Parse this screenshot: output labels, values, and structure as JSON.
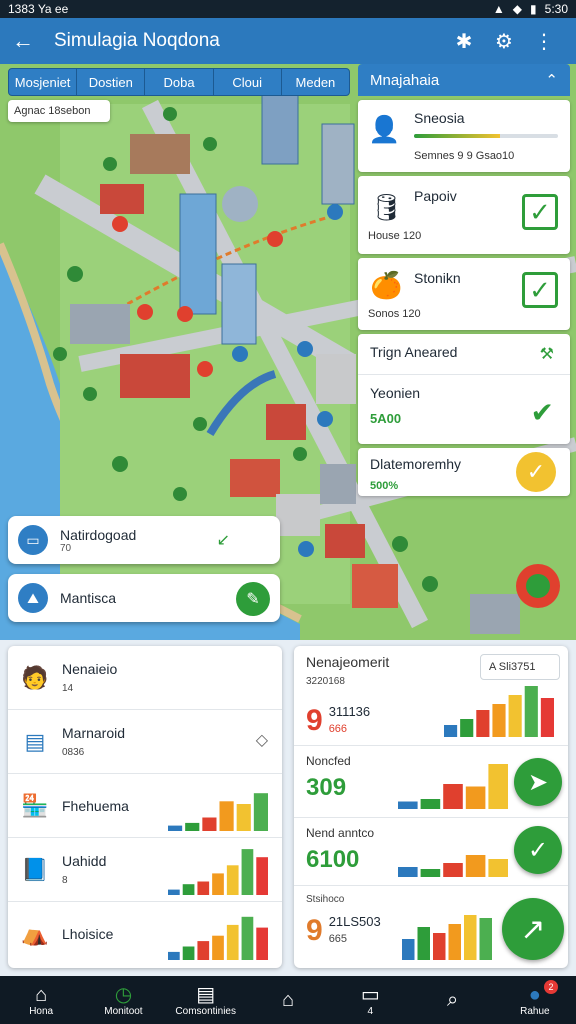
{
  "status": {
    "time": "1383 Ya ee",
    "battery": "5:30"
  },
  "appbar": {
    "title": "Simulagia Noqdona"
  },
  "tabs": [
    "Mosjeniet",
    "Dostien",
    "Doba",
    "Cloui",
    "Meden"
  ],
  "address": "Agnac 18sebon",
  "right_panel": {
    "title": "Mnajahaia",
    "items": [
      {
        "title": "Sneosia",
        "sub": "Semnes 9 9 Gsao10",
        "progress": 0.6
      },
      {
        "title": "Papoiv",
        "sub": "House 120"
      },
      {
        "title": "Stonikn",
        "sub": "Sonos 120"
      },
      {
        "title": "Trign Aneared"
      },
      {
        "title": "Yeonien",
        "value": "5A00"
      },
      {
        "title": "Dlatemoremhy",
        "value": "500%"
      }
    ]
  },
  "float_cards": [
    {
      "label": "Natirdogoad",
      "sub": "70"
    },
    {
      "label": "Mantisca"
    }
  ],
  "left_list": [
    {
      "name": "Nenaieio",
      "value": "14"
    },
    {
      "name": "Marnaroid",
      "value": "0836"
    },
    {
      "name": "Fhehuema"
    },
    {
      "name": "Uahidd",
      "value": "8"
    },
    {
      "name": "Lhoisice"
    }
  ],
  "metrics": {
    "title": "Nenajeomerit",
    "subtitle": "3220168",
    "search": "A Sli3751",
    "rows": [
      {
        "big": "9",
        "num": "311136",
        "sub": "666"
      },
      {
        "label": "Noncfed",
        "value": "309"
      },
      {
        "label": "Nend anntco",
        "value": "6100"
      },
      {
        "label": "Stsihoco",
        "big": "9",
        "num": "21LS503",
        "sub": "665"
      }
    ]
  },
  "chart_data": [
    {
      "type": "bar",
      "categories": [
        "1",
        "2",
        "3",
        "4",
        "5",
        "6"
      ],
      "values": [
        10,
        15,
        25,
        55,
        50,
        70
      ]
    },
    {
      "type": "bar",
      "categories": [
        "1",
        "2",
        "3",
        "4",
        "5",
        "6",
        "7"
      ],
      "values": [
        10,
        20,
        25,
        40,
        55,
        85,
        70
      ]
    },
    {
      "type": "bar",
      "categories": [
        "1",
        "2",
        "3",
        "4",
        "5",
        "6",
        "7"
      ],
      "values": [
        15,
        25,
        35,
        45,
        65,
        80,
        60
      ]
    },
    {
      "type": "bar",
      "categories": [
        "1",
        "2",
        "3",
        "4",
        "5",
        "6",
        "7"
      ],
      "values": [
        20,
        30,
        45,
        55,
        70,
        85,
        65
      ]
    },
    {
      "type": "bar",
      "categories": [
        "1",
        "2",
        "3",
        "4",
        "5"
      ],
      "values": [
        15,
        20,
        50,
        45,
        90
      ]
    },
    {
      "type": "bar",
      "categories": [
        "1",
        "2",
        "3",
        "4",
        "5"
      ],
      "values": [
        25,
        20,
        35,
        55,
        45
      ]
    },
    {
      "type": "bar",
      "categories": [
        "1",
        "2",
        "3",
        "4",
        "5",
        "6"
      ],
      "values": [
        35,
        55,
        45,
        60,
        75,
        70
      ]
    }
  ],
  "bottom_nav": [
    {
      "label": "Hona",
      "icon": "home-icon"
    },
    {
      "label": "Monitoot",
      "icon": "clock-icon"
    },
    {
      "label": "Comsontinies",
      "icon": "document-icon"
    },
    {
      "label": "",
      "icon": "house-icon"
    },
    {
      "label": "4",
      "icon": "inbox-icon"
    },
    {
      "label": "",
      "icon": "search-icon"
    },
    {
      "label": "Rahue",
      "icon": "globe-icon",
      "badge": "2"
    }
  ],
  "colors": {
    "accent": "#2c79bd",
    "green": "#2e9d3a",
    "orange": "#f29a1e",
    "red": "#e0402e",
    "yellow": "#f2c230"
  }
}
